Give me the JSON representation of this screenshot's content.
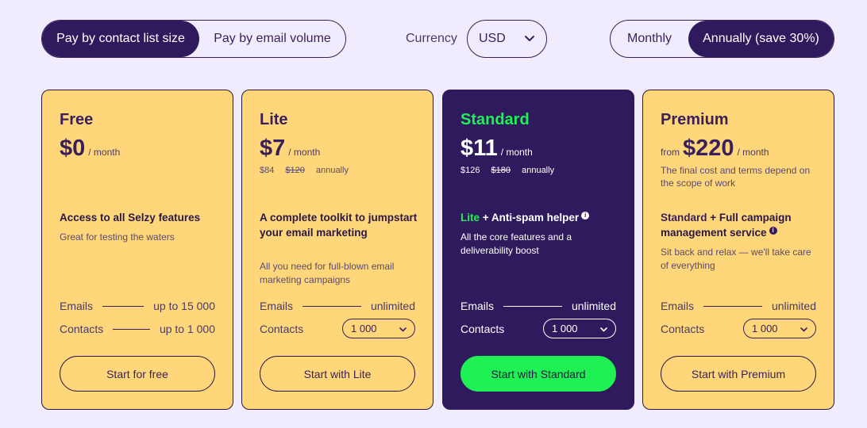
{
  "billing_basis": {
    "options": [
      "Pay by contact list size",
      "Pay by email volume"
    ],
    "selected": "Pay by contact list size"
  },
  "currency": {
    "label": "Currency",
    "value": "USD"
  },
  "billing_period": {
    "options": [
      "Monthly",
      "Annually (save 30%)"
    ],
    "selected": "Annually (save 30%)"
  },
  "colors": {
    "background": "#f1ecfd",
    "card": "#ffd77a",
    "dark": "#2e1a5c",
    "accent_green": "#1ff054"
  },
  "plans": [
    {
      "name": "Free",
      "price": "$0",
      "per": "/ month",
      "feature_title": "Access to all Selzy features",
      "feature_desc": "Great for testing the waters",
      "emails_label": "Emails",
      "emails_value": "up to 15 000",
      "contacts_label": "Contacts",
      "contacts_value": "up to 1 000",
      "cta": "Start for free"
    },
    {
      "name": "Lite",
      "price": "$7",
      "per": "/ month",
      "annual_price": "$84",
      "annual_old": "$120",
      "annual_word": "annually",
      "feature_title": "A complete toolkit to jumpstart your email marketing",
      "feature_desc": "All you need for full-blown email marketing campaigns",
      "emails_label": "Emails",
      "emails_value": "unlimited",
      "contacts_label": "Contacts",
      "contacts_select": "1 000",
      "cta": "Start with Lite"
    },
    {
      "name": "Standard",
      "price": "$11",
      "per": "/ month",
      "annual_price": "$126",
      "annual_old": "$180",
      "annual_word": "annually",
      "feature_highlight": "Lite",
      "feature_title_rest": "+ Anti-spam helper",
      "feature_desc": "All the core features and a deliverability boost",
      "emails_label": "Emails",
      "emails_value": "unlimited",
      "contacts_label": "Contacts",
      "contacts_select": "1 000",
      "cta": "Start with Standard"
    },
    {
      "name": "Premium",
      "price_prefix": "from",
      "price": "$220",
      "per": "/ month",
      "terms": "The final cost and terms depend on the scope of work",
      "feature_highlight": "Standard",
      "feature_title_rest": "+ Full campaign management service",
      "feature_desc": "Sit back and relax — we'll take care of everything",
      "emails_label": "Emails",
      "emails_value": "unlimited",
      "contacts_label": "Contacts",
      "contacts_select": "1 000",
      "cta": "Start with Premium"
    }
  ]
}
